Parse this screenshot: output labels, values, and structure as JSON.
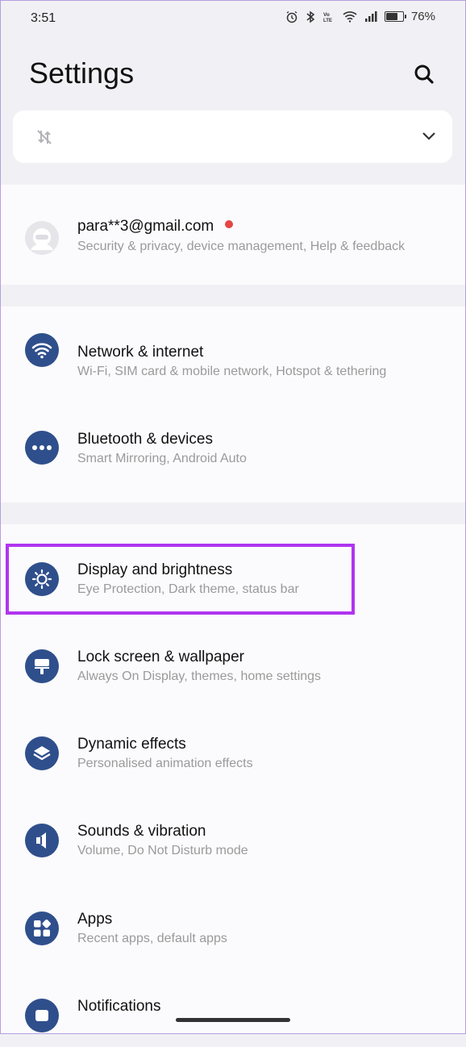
{
  "status_bar": {
    "time": "3:51",
    "battery": "76%",
    "battery_level": 0.76,
    "icons": [
      "alarm-icon",
      "bluetooth-icon",
      "volte-icon",
      "wifi-icon",
      "signal-icon",
      "battery-icon"
    ]
  },
  "header": {
    "title": "Settings",
    "search_icon": "search-icon"
  },
  "quick_card": {
    "icon": "mobile-data-off-icon",
    "expand_icon": "chevron-down-icon"
  },
  "account": {
    "email": "para**3@gmail.com",
    "subtitle": "Security & privacy, device management, Help & feedback",
    "has_notification": true
  },
  "items": [
    {
      "id": "network",
      "title": "Network & internet",
      "subtitle": "Wi-Fi, SIM card & mobile network, Hotspot & tethering",
      "icon": "wifi-icon"
    },
    {
      "id": "bluetooth",
      "title": "Bluetooth & devices",
      "subtitle": "Smart Mirroring, Android Auto",
      "icon": "more-dots-icon"
    },
    {
      "id": "display",
      "title": "Display and brightness",
      "subtitle": "Eye Protection, Dark theme, status bar",
      "icon": "brightness-icon",
      "highlighted": true
    },
    {
      "id": "lockscreen",
      "title": "Lock screen & wallpaper",
      "subtitle": "Always On Display, themes, home settings",
      "icon": "wallpaper-icon"
    },
    {
      "id": "dynamic",
      "title": "Dynamic effects",
      "subtitle": "Personalised animation effects",
      "icon": "layers-icon"
    },
    {
      "id": "sounds",
      "title": "Sounds & vibration",
      "subtitle": "Volume, Do Not Disturb mode",
      "icon": "speaker-icon"
    },
    {
      "id": "apps",
      "title": "Apps",
      "subtitle": "Recent apps, default apps",
      "icon": "apps-grid-icon"
    },
    {
      "id": "notifications",
      "title": "Notifications",
      "subtitle": "",
      "icon": "notification-icon"
    }
  ],
  "colors": {
    "icon_bg": "#2f4f8c",
    "highlight": "#b035f0",
    "notification_dot": "#e64545"
  }
}
